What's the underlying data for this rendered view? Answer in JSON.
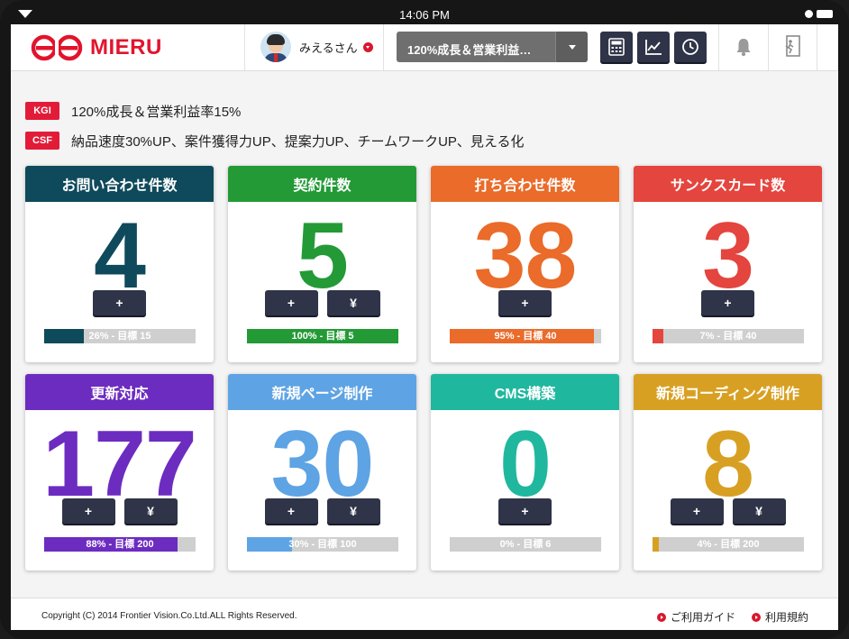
{
  "status_bar": {
    "time": "14:06 PM"
  },
  "app": {
    "logo_text": "MIERU"
  },
  "header": {
    "user_name": "みえるさん",
    "goal_select_value": "120%成長＆営業利益…"
  },
  "kgi": {
    "tag": "KGI",
    "text": "120%成長＆営業利益率15%"
  },
  "csf": {
    "tag": "CSF",
    "text": "納品速度30%UP、案件獲得力UP、提案力UP、チームワークUP、見える化"
  },
  "buttons": {
    "plus": "+",
    "yen": "¥"
  },
  "cards": [
    {
      "title": "お問い合わせ件数",
      "count": "4",
      "color": "#0e4a5b",
      "progress": 0.26,
      "progress_label": "26% - 目標 15",
      "has_yen": false
    },
    {
      "title": "契約件数",
      "count": "5",
      "color": "#239a36",
      "progress": 1.0,
      "progress_label": "100% - 目標 5",
      "has_yen": true
    },
    {
      "title": "打ち合わせ件数",
      "count": "38",
      "color": "#ea6b2a",
      "progress": 0.95,
      "progress_label": "95% - 目標 40",
      "has_yen": false
    },
    {
      "title": "サンクスカード数",
      "count": "3",
      "color": "#e4453e",
      "progress": 0.07,
      "progress_label": "7% - 目標 40",
      "has_yen": false
    },
    {
      "title": "更新対応",
      "count": "177",
      "color": "#6c2cc0",
      "progress": 0.88,
      "progress_label": "88% - 目標 200",
      "has_yen": true
    },
    {
      "title": "新規ページ制作",
      "count": "30",
      "color": "#5ea3e4",
      "progress": 0.3,
      "progress_label": "30% - 目標 100",
      "has_yen": true
    },
    {
      "title": "CMS構築",
      "count": "0",
      "color": "#20b79f",
      "progress": 0.0,
      "progress_label": "0% - 目標 6",
      "has_yen": false
    },
    {
      "title": "新規コーディング制作",
      "count": "8",
      "color": "#d8a023",
      "progress": 0.04,
      "progress_label": "4% - 目標 200",
      "has_yen": true
    }
  ],
  "footer": {
    "copyright": "Copyright (C) 2014 Frontier Vision.Co.Ltd.ALL Rights Reserved.",
    "guide_link": "ご利用ガイド",
    "terms_link": "利用規約"
  },
  "icons": {
    "calculator": "calculator-icon",
    "chart": "line-chart-icon",
    "clock": "clock-icon",
    "bell": "bell-icon",
    "logout": "logout-icon"
  }
}
